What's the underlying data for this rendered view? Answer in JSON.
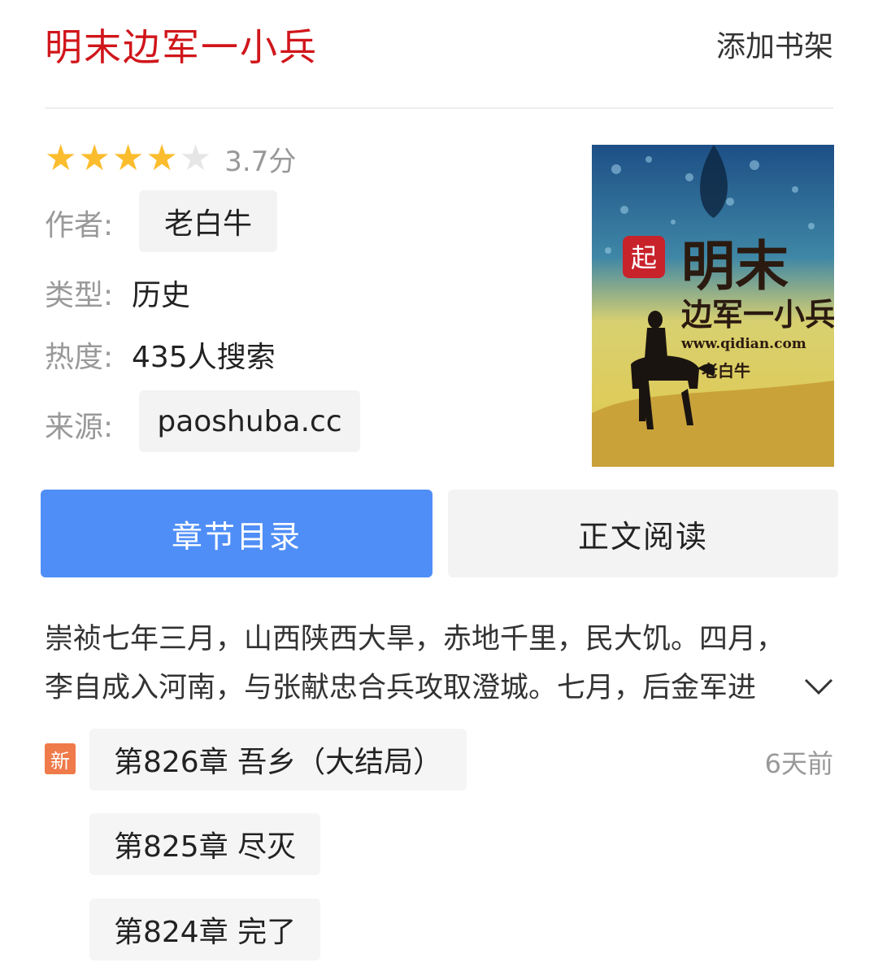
{
  "header": {
    "title": "明末边军一小兵",
    "add_shelf": "添加书架"
  },
  "rating": {
    "stars_filled": 4,
    "stars_total": 5,
    "score_text": "3.7分"
  },
  "meta": {
    "author_label": "作者:",
    "author": "老白牛",
    "genre_label": "类型:",
    "genre": "历史",
    "heat_label": "热度:",
    "heat": "435人搜索",
    "source_label": "来源:",
    "source": "paoshuba.cc"
  },
  "cover": {
    "badge": "起",
    "title_line1": "明末",
    "title_line2": "边军一小兵",
    "url": "www.qidian.com",
    "author": "老白牛"
  },
  "actions": {
    "toc": "章节目录",
    "read": "正文阅读"
  },
  "intro": {
    "line1": "崇祯七年三月，山西陕西大旱，赤地千里，民大饥。四月，",
    "line2": "李自成入河南，与张献忠合兵攻取澄城。七月，后金军进"
  },
  "chapters": {
    "new_badge": "新",
    "latest_time": "6天前",
    "items": [
      {
        "title": "第826章 吾乡（大结局）"
      },
      {
        "title": "第825章 尽灭"
      },
      {
        "title": "第824章 完了"
      }
    ]
  },
  "colors": {
    "title_red": "#d0161b",
    "primary_blue": "#4f8ef7",
    "star_gold": "#fbbd2e",
    "new_orange": "#ef7a4a"
  }
}
